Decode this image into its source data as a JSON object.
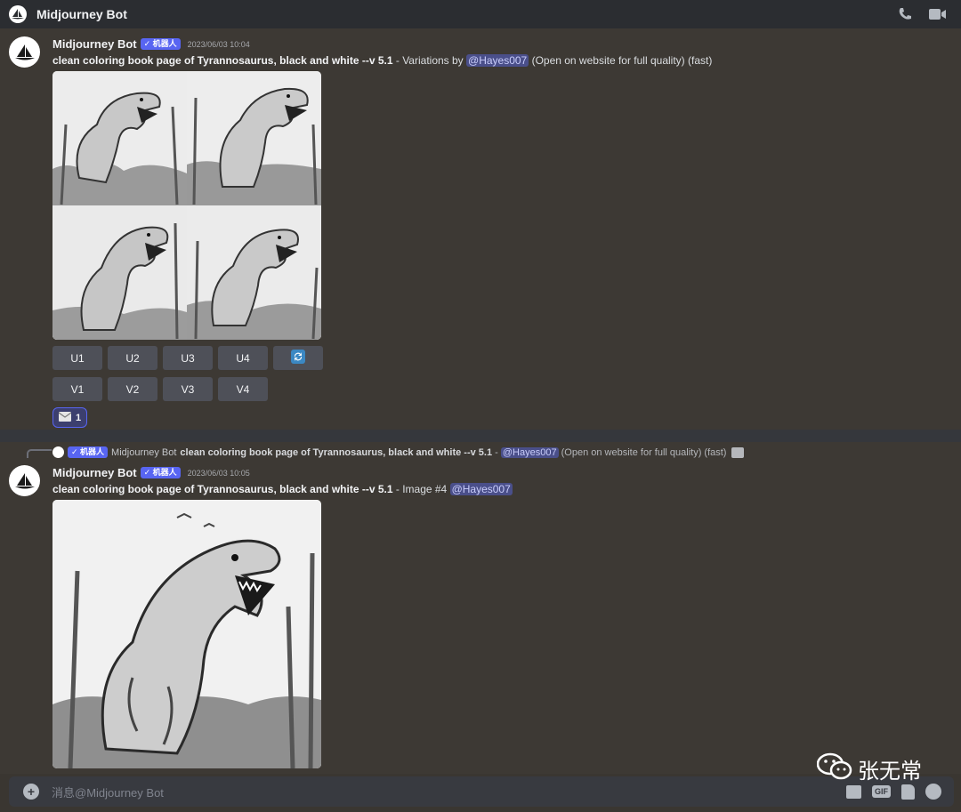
{
  "topbar": {
    "title": "Midjourney Bot",
    "icons": [
      "phone-call-icon",
      "video-camera-icon"
    ]
  },
  "message1": {
    "username": "Midjourney Bot",
    "bot_badge": "✓ 机器人",
    "timestamp": "2023/06/03 10:04",
    "prompt": "clean coloring book page of Tyrannosaurus, black and white --v 5.1",
    "suffix_before_mention": " - Variations by ",
    "mention": "@Hayes007",
    "suffix_after_mention": " (Open on website for full quality) (fast)",
    "upscale_buttons": [
      "U1",
      "U2",
      "U3",
      "U4"
    ],
    "variation_buttons": [
      "V1",
      "V2",
      "V3",
      "V4"
    ],
    "reroll_icon": "refresh-icon",
    "reaction": {
      "emoji": "envelope-icon",
      "count": "1"
    }
  },
  "message2": {
    "reply": {
      "badge": "✓ 机器人",
      "name": "Midjourney Bot",
      "prompt": "clean coloring book page of Tyrannosaurus, black and white --v 5.1",
      "sep": " - ",
      "mention": "@Hayes007",
      "suffix": " (Open on website for full quality) (fast)"
    },
    "username": "Midjourney Bot",
    "bot_badge": "✓ 机器人",
    "timestamp": "2023/06/03 10:05",
    "prompt": "clean coloring book page of Tyrannosaurus, black and white --v 5.1",
    "suffix_before_mention": " - Image #4 ",
    "mention": "@Hayes007"
  },
  "composer": {
    "placeholder": "消息@Midjourney Bot",
    "tools": [
      "gift-icon",
      "gif-button",
      "sticker-icon",
      "emoji-icon"
    ]
  },
  "watermark": {
    "text": "张无常"
  },
  "colors": {
    "accent": "#5865f2",
    "mention_bg": "#4a4f8a",
    "background": "#3d3934"
  }
}
